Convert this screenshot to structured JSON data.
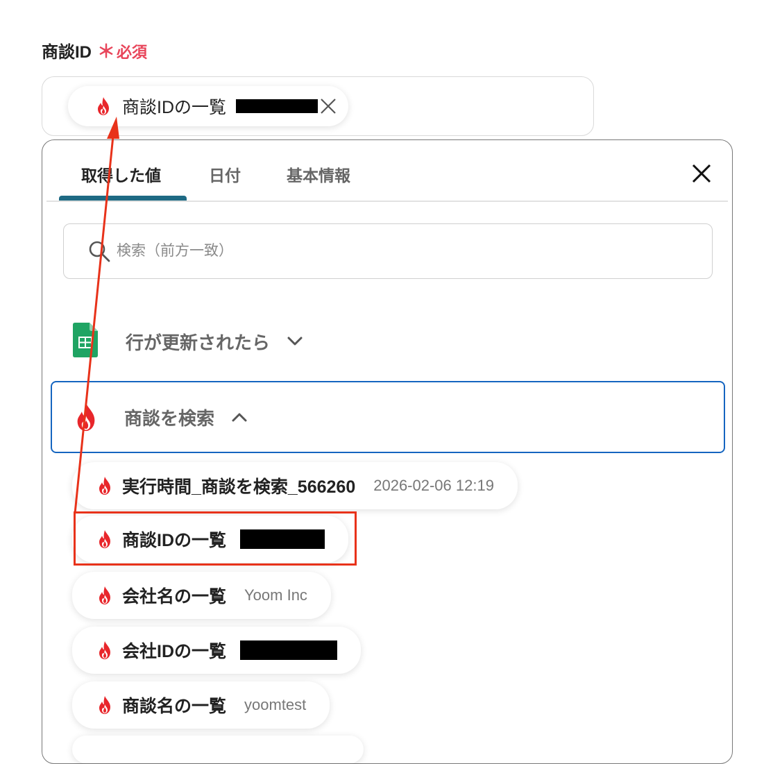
{
  "field": {
    "label": "商談ID",
    "required_star": "＊",
    "required_text": "必須",
    "selected_chip": {
      "label": "商談IDの一覧",
      "icon": "flame-icon",
      "value_redacted": true
    }
  },
  "panel": {
    "tabs": [
      {
        "label": "取得した値",
        "active": true
      },
      {
        "label": "日付",
        "active": false
      },
      {
        "label": "基本情報",
        "active": false
      }
    ],
    "search_placeholder": "検索（前方一致）",
    "groups": [
      {
        "label": "行が更新されたら",
        "icon": "google-sheets-icon",
        "expanded": false
      },
      {
        "label": "商談を検索",
        "icon": "flame-icon",
        "expanded": true
      }
    ],
    "outputs": [
      {
        "name": "実行時間_商談を検索_566260",
        "value": "2026-02-06 12:19"
      },
      {
        "name": "商談IDの一覧",
        "value": "",
        "redacted": true
      },
      {
        "name": "会社名の一覧",
        "value": "Yoom Inc"
      },
      {
        "name": "会社IDの一覧",
        "value": "",
        "redacted": true
      },
      {
        "name": "商談名の一覧",
        "value": "yoomtest"
      }
    ]
  },
  "colors": {
    "accent": "#1e6a84",
    "focus_border": "#1565c0",
    "required": "#e8455a",
    "annotation": "#e8321a",
    "flame": "#e8262b"
  }
}
